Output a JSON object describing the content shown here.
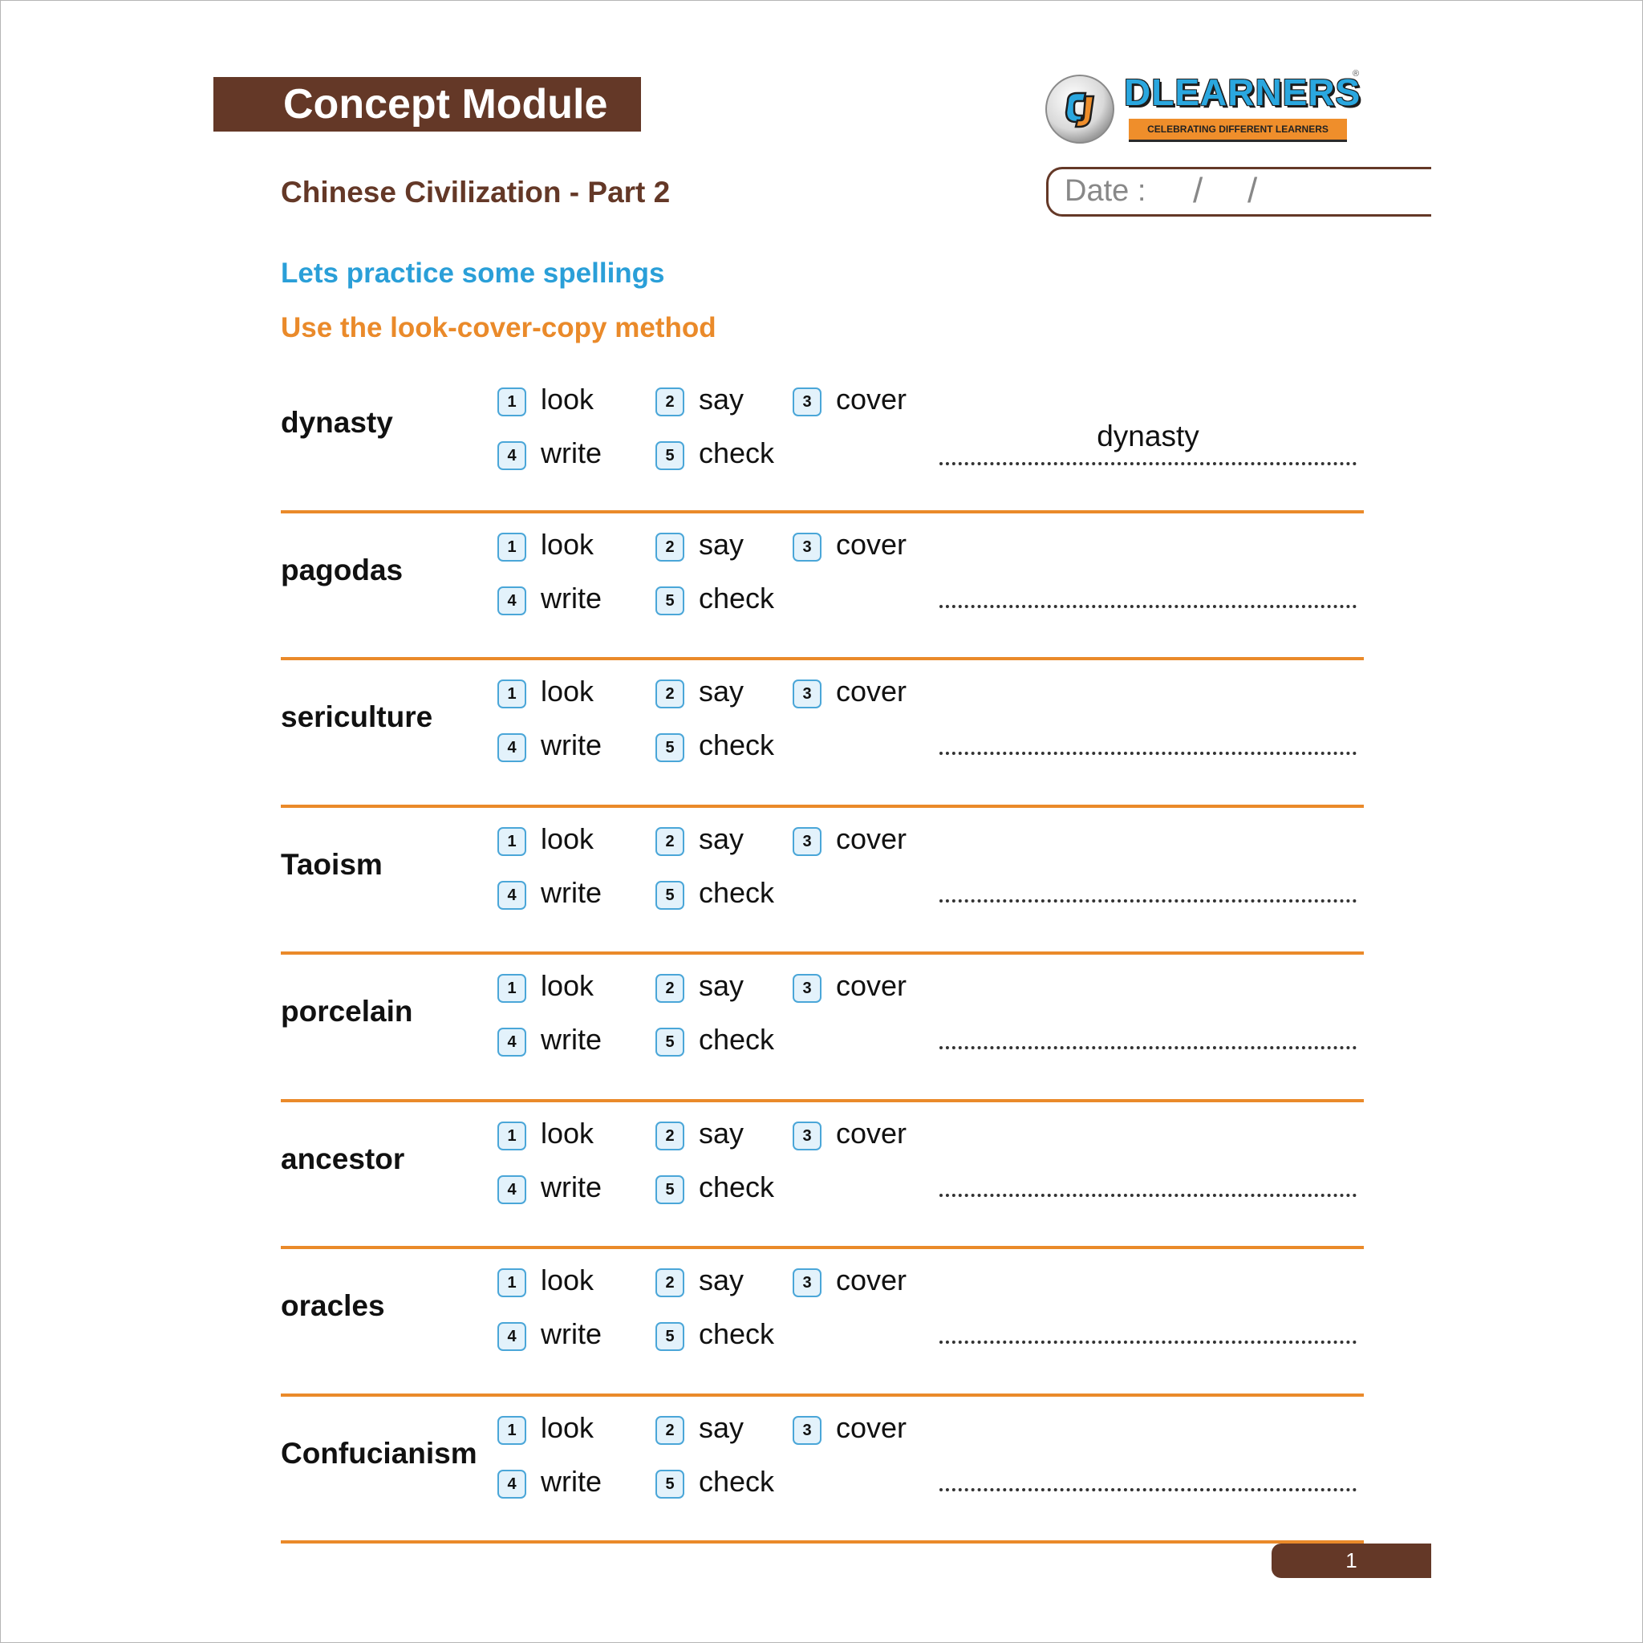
{
  "header": {
    "module_title": "Concept Module",
    "subtitle": "Chinese Civilization - Part 2",
    "date_label": "Date :",
    "date_separator": "/"
  },
  "logo": {
    "name": "DLEARNERS",
    "tagline": "CELEBRATING DIFFERENT LEARNERS",
    "registered_mark": "®"
  },
  "instructions": {
    "line1": "Lets practice some spellings",
    "line2": "Use the look-cover-copy method"
  },
  "steps": [
    {
      "num": "1",
      "label": "look"
    },
    {
      "num": "2",
      "label": "say"
    },
    {
      "num": "3",
      "label": "cover"
    },
    {
      "num": "4",
      "label": "write"
    },
    {
      "num": "5",
      "label": "check"
    }
  ],
  "words": [
    {
      "word": "dynasty",
      "answer": "dynasty"
    },
    {
      "word": "pagodas",
      "answer": ""
    },
    {
      "word": "sericulture",
      "answer": ""
    },
    {
      "word": "Taoism",
      "answer": ""
    },
    {
      "word": "porcelain",
      "answer": ""
    },
    {
      "word": "ancestor",
      "answer": ""
    },
    {
      "word": "oracles",
      "answer": ""
    },
    {
      "word": "Confucianism",
      "answer": ""
    }
  ],
  "footer": {
    "page_number": "1"
  },
  "colors": {
    "brown": "#643827",
    "orange": "#ea8a2a",
    "blue": "#2a9fd8"
  }
}
